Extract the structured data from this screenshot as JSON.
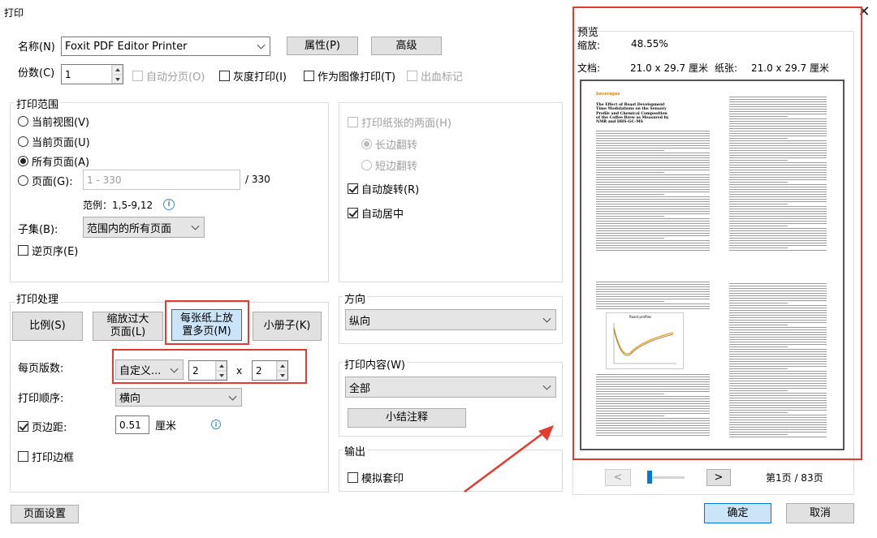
{
  "window": {
    "title": "打印"
  },
  "printer": {
    "name_label": "名称(N)",
    "name_value": "Foxit PDF Editor Printer",
    "properties_button": "属性(P)",
    "advanced_button": "高级"
  },
  "copies": {
    "label": "份数(C)",
    "value": "1",
    "auto_collate": "自动分页(O)",
    "grayscale": "灰度打印(I)",
    "print_as_image": "作为图像打印(T)",
    "bleed_marks": "出血标记"
  },
  "range": {
    "title": "打印范围",
    "current_view": "当前视图(V)",
    "current_page": "当前页面(U)",
    "all_pages": "所有页面(A)",
    "pages": "页面(G):",
    "pages_placeholder": "1 - 330",
    "total": "/ 330",
    "example": "范例：1,5-9,12",
    "subset_label": "子集(B):",
    "subset_value": "范围内的所有页面",
    "reverse": "逆页序(E)"
  },
  "duplex": {
    "both_sides": "打印纸张的两面(H)",
    "long_edge": "长边翻转",
    "short_edge": "短边翻转",
    "auto_rotate": "自动旋转(R)",
    "auto_center": "自动居中"
  },
  "handling": {
    "title": "打印处理",
    "scale_button": "比例(S)",
    "shrink_button": "缩放过大页面(L)",
    "multiple_button": "每张纸上放置多页(M)",
    "booklet_button": "小册子(K)",
    "pages_per_sheet_label": "每页版数:",
    "pages_per_sheet_value": "自定义...",
    "cols": "2",
    "x": "x",
    "rows": "2",
    "order_label": "打印顺序:",
    "order_value": "横向",
    "margin_label": "页边距:",
    "margin_value": "0.51",
    "margin_unit": "厘米",
    "border": "打印边框"
  },
  "orientation": {
    "title": "方向",
    "value": "纵向"
  },
  "content": {
    "title": "打印内容(W)",
    "value": "全部",
    "summarize_button": "小结注释"
  },
  "output": {
    "title": "输出",
    "simulate_overprint": "模拟套印"
  },
  "preview": {
    "title": "预览",
    "zoom_label": "缩放:",
    "zoom_value": "48.55%",
    "doc_label": "文档:",
    "doc_value": "21.0 x 29.7 厘米",
    "paper_label": "纸张:",
    "paper_value": "21.0 x 29.7 厘米",
    "prev": "<",
    "next": ">",
    "page_info": "第1页 / 83页"
  },
  "preview_doc": {
    "journal": "beverages",
    "heading": "The Effect of Roast Development Time Modulations on the Sensory Profile and Chemical Composition of the Coffee Brew as Measured by NMR and DHS-GC–MS",
    "chart_title": "Roast profiles"
  },
  "footer": {
    "page_setup": "页面设置",
    "ok": "确定",
    "cancel": "取消"
  },
  "colors": {
    "highlight_red": "#e23b30",
    "selected_blue": "#cce4f7"
  }
}
